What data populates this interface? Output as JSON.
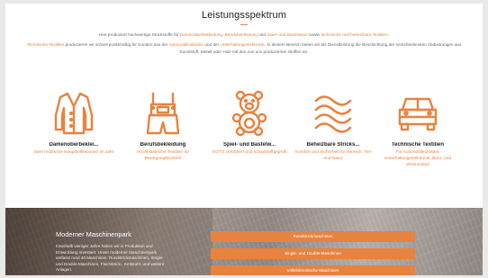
{
  "section": {
    "title": "Leistungsspektrum"
  },
  "intro": {
    "p1_pre": "Hier produziert hochwertige Strickstoffe für ",
    "p1_hl1": "Damenoberbekleidung, Berufsbekleidung",
    "p1_mid": " und ",
    "p1_hl2": "Spiel- und Bastelware",
    "p1_mid2": " sowie ",
    "p1_hl3": "technische und beheizbare Textilien",
    "p1_end": ".",
    "p2_hl1": "Technische Textilien",
    "p2_mid": " produzieren wir schwerpunktmäßig für Kunden aus der ",
    "p2_hl2": "Automobilindustrie",
    "p2_mid2": " und der ",
    "p2_hl3": "Unterhaltungselektronik",
    "p2_end": ". In diesem Bereich bieten wir als Dienstleistung die Beschichtung der verschiedensten Abdeckungen aus Kunststoff, Metall oder Holz mit den von uns produzierten Stoffen an."
  },
  "categories": [
    {
      "icon": "cardigan-icon",
      "label": "Damenoberbeklei...",
      "desc": "Zwei modische Hauptkollektionen im Jahr"
    },
    {
      "icon": "overalls-icon",
      "label": "Berufsbekleidung",
      "desc": "Hochelastische Textilien für Bewegungskomfort"
    },
    {
      "icon": "teddy-bear-icon",
      "label": "Spiel- und Bastelw...",
      "desc": "GOTS zertifiziert und schadstoffgeprüft"
    },
    {
      "icon": "heat-waves-icon",
      "label": "Beheizbare Stricks...",
      "desc": "Komfort und Sicherheit für Mensch, Tier und Natur"
    },
    {
      "icon": "car-icon",
      "label": "Technische Textilien",
      "desc": "Für Automobilindustrie, Unterhaltungselektronik, Büro- und Wohnmöbel"
    }
  ],
  "machine_park": {
    "title": "Moderner Maschinenpark",
    "text": "Innerhalb weniger Jahre haben wir in Produktion und Entwicklung investiert. Unser moderner Maschinenpark umfasst rund 40 Maschinen: Rundstrickmaschinen, Single- und Double-Maschinen, Flachstrick-, Kettstuhl- und weitere Anlagen.",
    "buttons": [
      "Rundstrickmaschinen",
      "Single- und Double-Maschinen",
      "Vollelektronische Maschinen"
    ]
  },
  "colors": {
    "accent": "#e8823f",
    "heading": "#222222",
    "body_text": "#666666"
  }
}
